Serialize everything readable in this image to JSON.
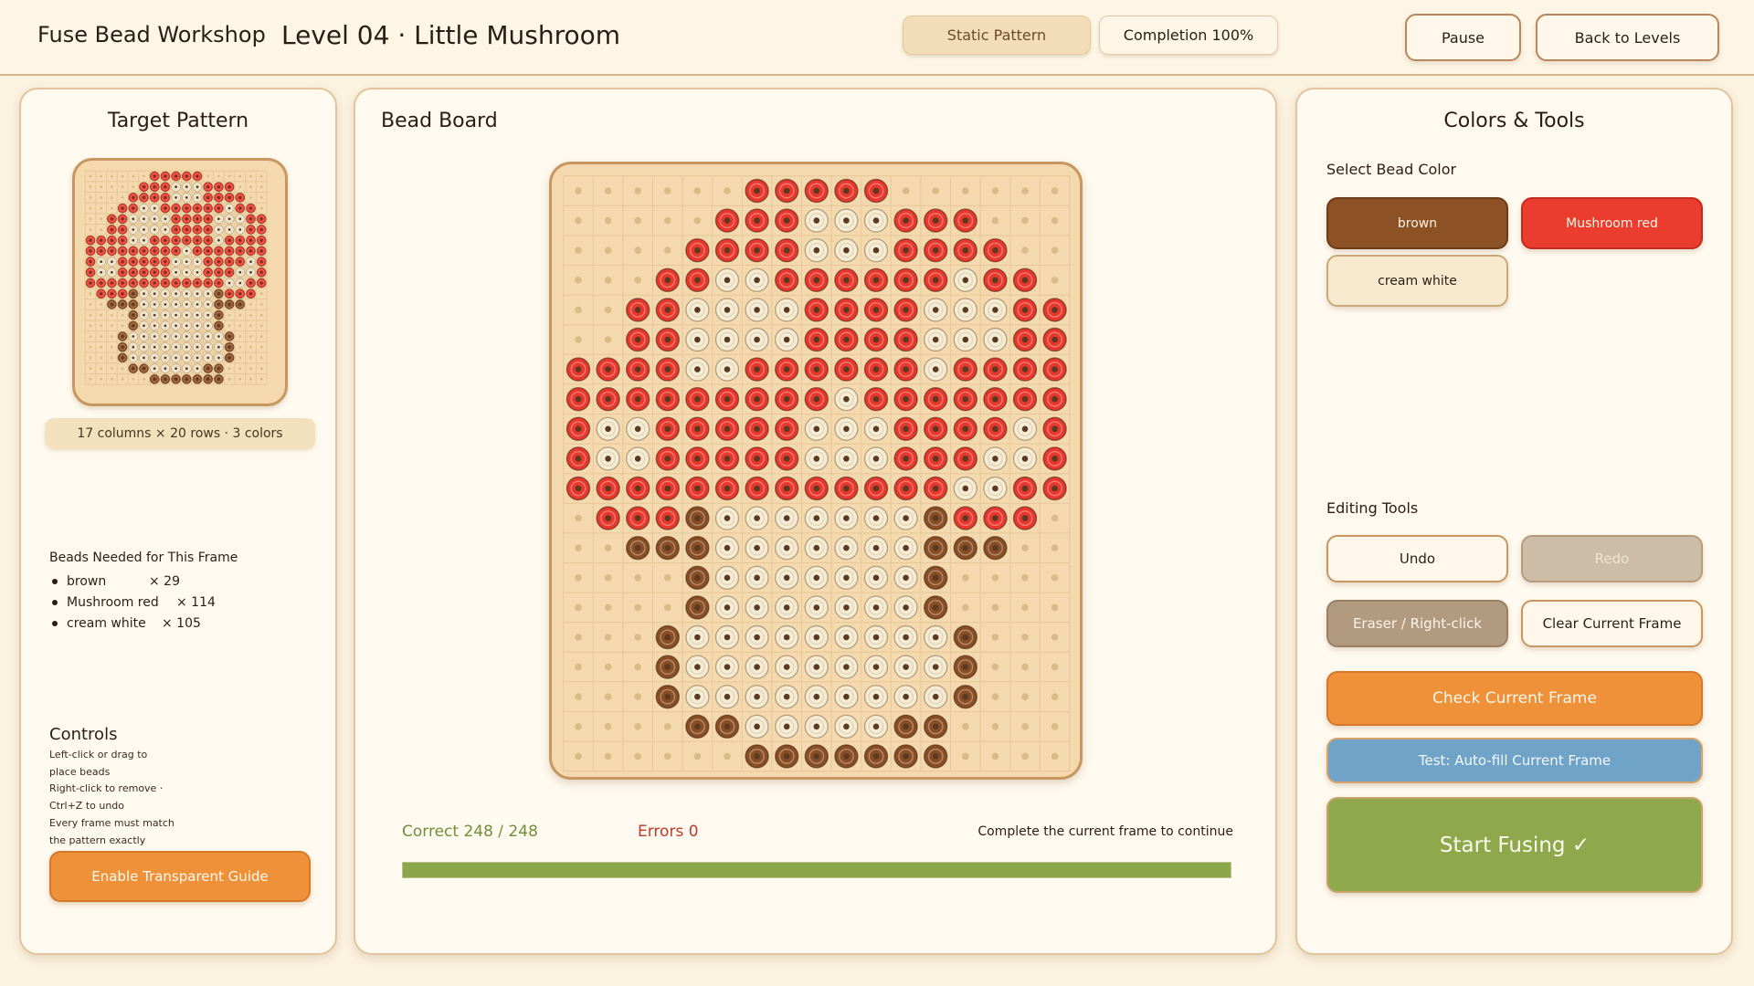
{
  "header": {
    "app_title": "Fuse Bead Workshop",
    "level_title": "Level 04 · Little Mushroom",
    "static_label": "Static Pattern",
    "completion_label": "Completion 100%",
    "pause_label": "Pause",
    "back_label": "Back to Levels"
  },
  "left": {
    "title": "Target Pattern",
    "dims": "17 columns × 20 rows · 3 colors",
    "needed_title": "Beads Needed for This Frame",
    "needed": [
      {
        "name": "brown",
        "count": "× 29"
      },
      {
        "name": "Mushroom red",
        "count": "× 114"
      },
      {
        "name": "cream white",
        "count": "× 105"
      }
    ],
    "controls_title": "Controls",
    "controls_lines": [
      "Left-click or drag to",
      "place beads",
      "Right-click to remove ·",
      "Ctrl+Z to undo",
      "Every frame must match",
      "the pattern exactly"
    ],
    "guide_label": "Enable Transparent Guide"
  },
  "middle": {
    "title": "Bead Board",
    "correct_label": "Correct 248 / 248",
    "errors_label": "Errors 0",
    "hint": "Complete the current frame to continue",
    "progress": 1.0
  },
  "right": {
    "title": "Colors & Tools",
    "select_label": "Select Bead Color",
    "colors": {
      "brown": "brown",
      "red": "Mushroom red",
      "cream": "cream white"
    },
    "editing_label": "Editing Tools",
    "undo_label": "Undo",
    "redo_label": "Redo",
    "eraser_label": "Eraser / Right-click",
    "clear_label": "Clear Current Frame",
    "check_label": "Check Current Frame",
    "test_label": "Test: Auto-fill Current Frame",
    "fuse_label": "Start Fusing ✓"
  },
  "palette": {
    "R": "#e8372c",
    "W": "#f5ecd6",
    "B": "#8a4e24",
    "peg": "#d8bb86"
  },
  "pattern": {
    "cols": 17,
    "rows": 20,
    "grid": [
      "......RRRRR......",
      ".....RRRWWWRRR...",
      "....RRRRWWWRRRR..",
      "...RRWWRRRRRRWRR.",
      "..RRWWWWRRRRWWWRR",
      "..RRWWWWRRRRWWWRR",
      "RRRRWWRRRRRRWRRRR",
      "RRRRRRRRRWRRRRRRR",
      "RWWRRRRRWWWRRRRWR",
      "RWWRRRRRWWWRRRWWR",
      "RRRRRRRRRRRRRWWRR",
      ".RRRBWWWWWWWBRRR.",
      "..BBBWWWWWWWBBB..",
      "....BWWWWWWWB....",
      "....BWWWWWWWB....",
      "...BWWWWWWWWWB...",
      "...BWWWWWWWWWB...",
      "...BWWWWWWWWWB...",
      "....BBWWWWWBB....",
      "......BBBBBBB...."
    ]
  }
}
